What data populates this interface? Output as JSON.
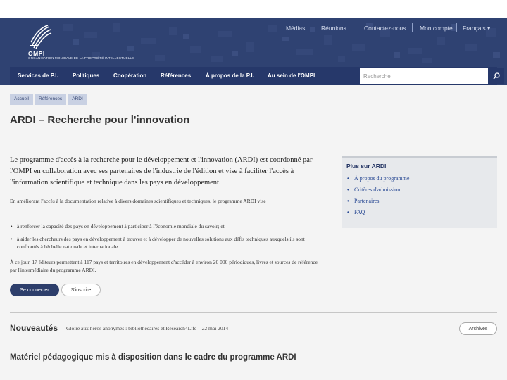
{
  "top_links": {
    "medias": "Médias",
    "reunions": "Réunions",
    "contact": "Contactez-nous",
    "account": "Mon compte",
    "language": "Français ▾"
  },
  "logo": {
    "name": "OMPI",
    "subtitle": "ORGANISATION MONDIALE DE LA PROPRIÉTÉ INTELLECTUELLE"
  },
  "nav": {
    "items": [
      "Services de P.I.",
      "Politiques",
      "Coopération",
      "Références",
      "À propos de la P.I.",
      "Au sein de l'OMPI"
    ],
    "search_placeholder": "Recherche"
  },
  "breadcrumb": [
    "Accueil",
    "Références",
    "ARDI"
  ],
  "main": {
    "title": "ARDI – Recherche pour l'innovation",
    "lead": "Le programme d'accès à la recherche pour le développement et l'innovation (ARDI) est coordonné par l'OMPI en collaboration avec ses partenaires de l'industrie de l'édition et vise à faciliter l'accès à l'information scientifique et technique dans les pays en développement.",
    "intro": "En améliorant l'accès à la documentation relative à divers domaines scientifiques et techniques, le programme ARDI vise :",
    "bullets": [
      "à renforcer la capacité des pays en développement à participer à l'économie mondiale du savoir; et",
      "à aider les chercheurs des pays en développement à trouver et à développer de nouvelles solutions aux défis techniques auxquels ils sont confrontés à l'échelle nationale et internationale."
    ],
    "para2": "À ce jour, 17 éditeurs permettent à 117 pays et territoires en développement d'accéder à environ 20 000 périodiques, livres et sources de référence par l'intermédiaire du programme ARDI.",
    "login_label": "Se connecter",
    "register_label": "S'inscrire"
  },
  "sidebar": {
    "title": "Plus sur ARDI",
    "links": [
      "À propos du programme",
      "Critères d'admission",
      "Partenaires",
      "FAQ"
    ]
  },
  "news": {
    "title": "Nouveautés",
    "item": "Gloire aux héros anonymes : bibliothécaires et Research4Life",
    "date": "22 mai 2014",
    "archives_label": "Archives"
  },
  "materials": {
    "title": "Matériel pédagogique mis à disposition dans le cadre du programme ARDI"
  },
  "colors": {
    "header": "#2f4272",
    "navbar": "#26386a",
    "link": "#2a4a94"
  }
}
